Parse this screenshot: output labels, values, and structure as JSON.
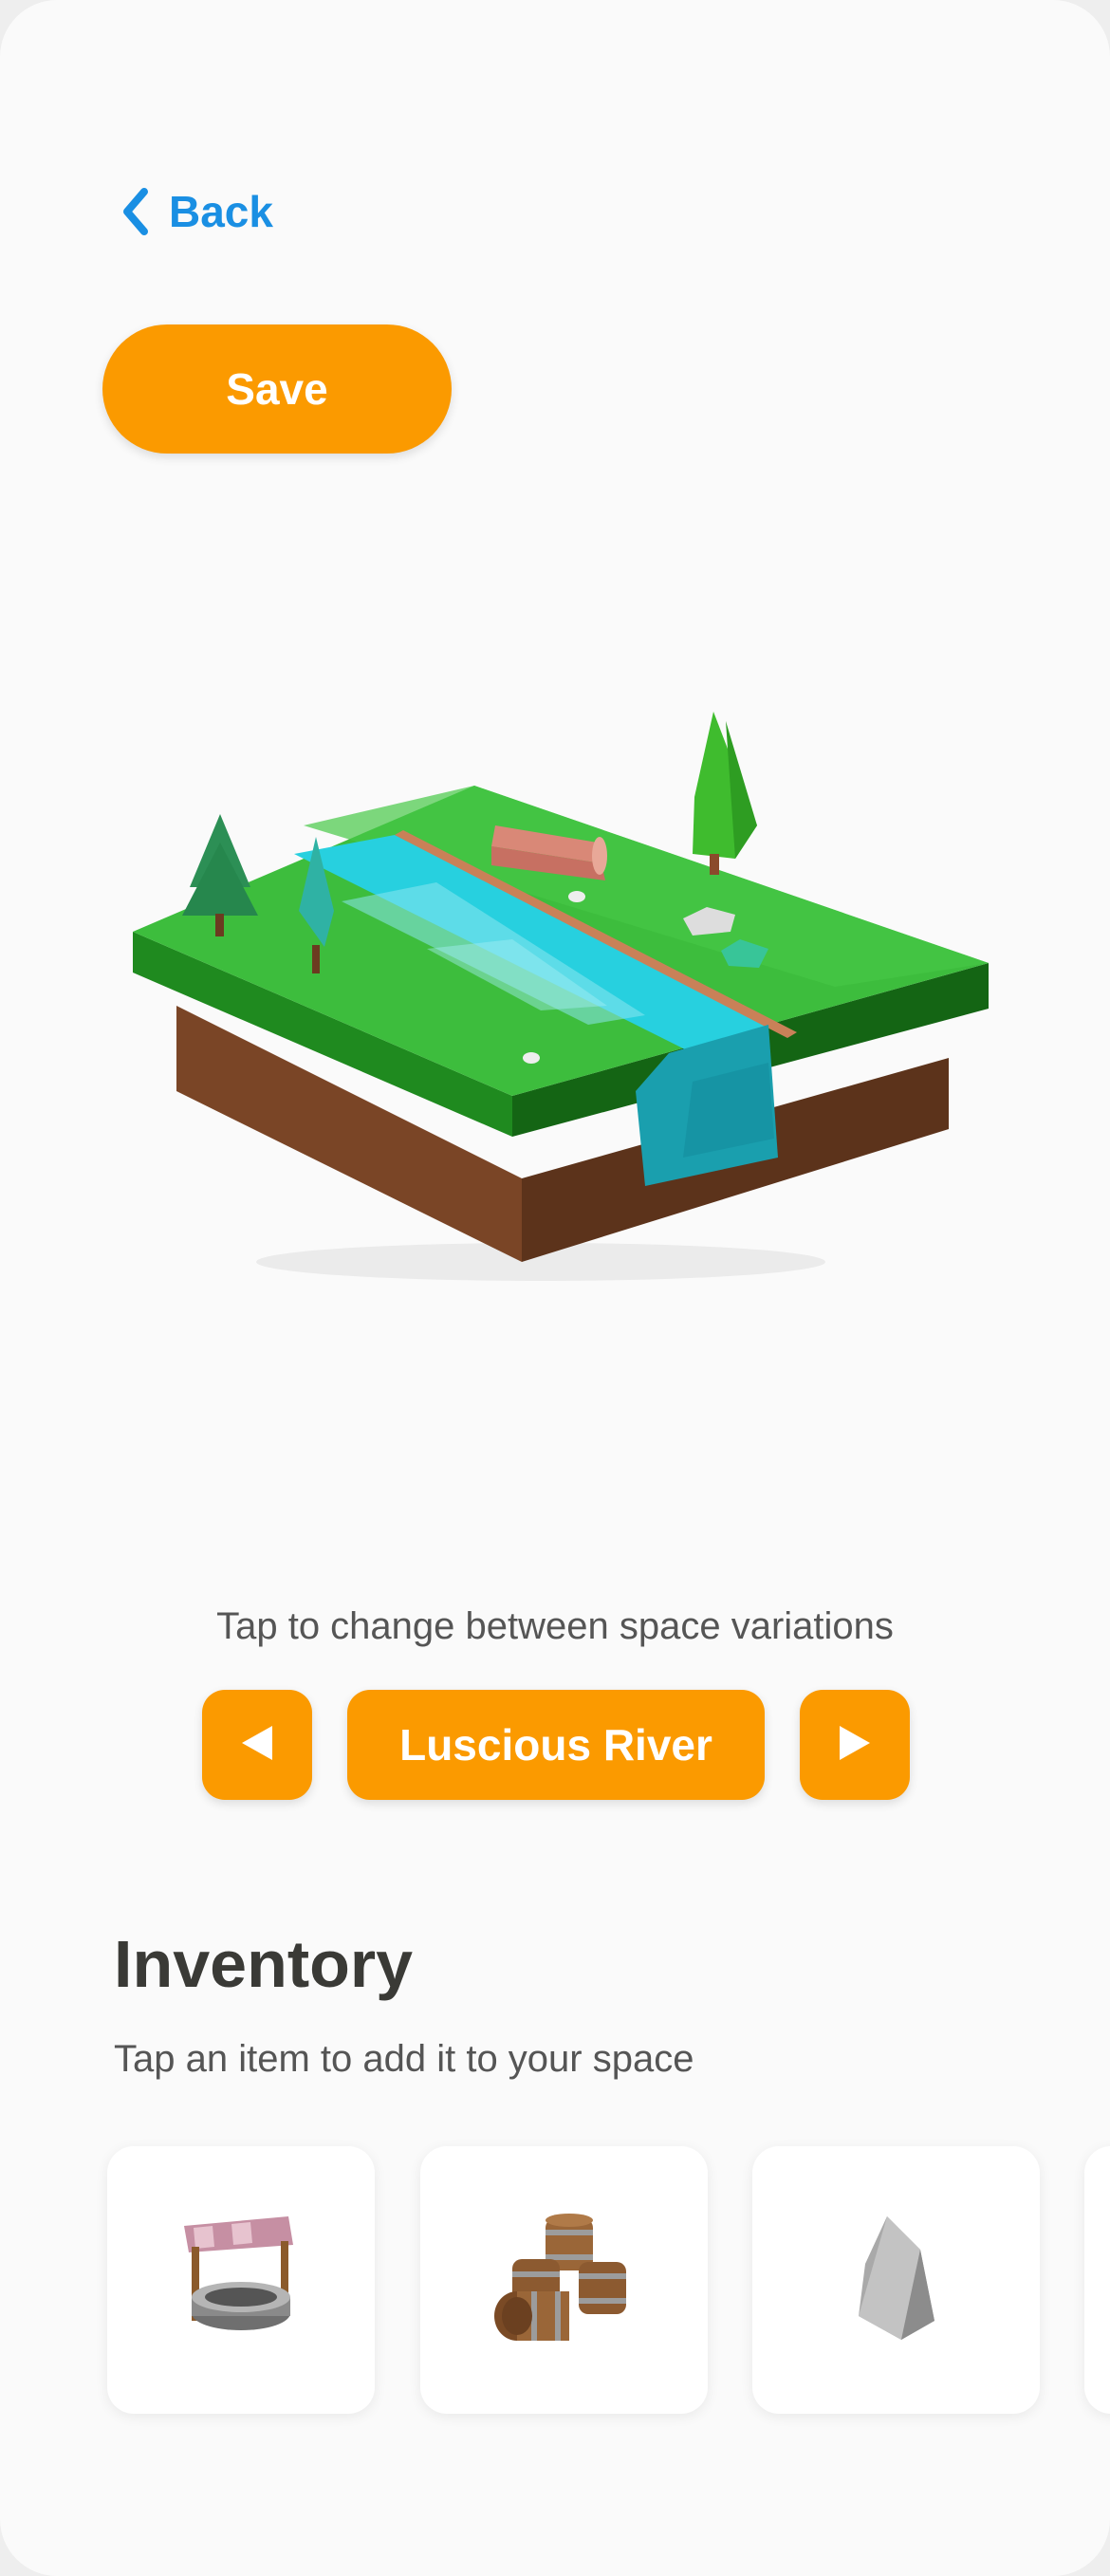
{
  "header": {
    "back_label": "Back",
    "save_label": "Save"
  },
  "scene": {
    "name": "low-poly-river-island"
  },
  "variations": {
    "hint": "Tap to change between space variations",
    "current": "Luscious River",
    "prev_icon": "triangle-left-icon",
    "next_icon": "triangle-right-icon"
  },
  "inventory": {
    "title": "Inventory",
    "subtitle": "Tap an item to add it to your space",
    "items": [
      {
        "icon": "well-icon"
      },
      {
        "icon": "barrels-icon"
      },
      {
        "icon": "rock-icon"
      }
    ]
  },
  "colors": {
    "accent": "#fb9a00",
    "link": "#1a8fe3",
    "background": "#fafafa"
  }
}
